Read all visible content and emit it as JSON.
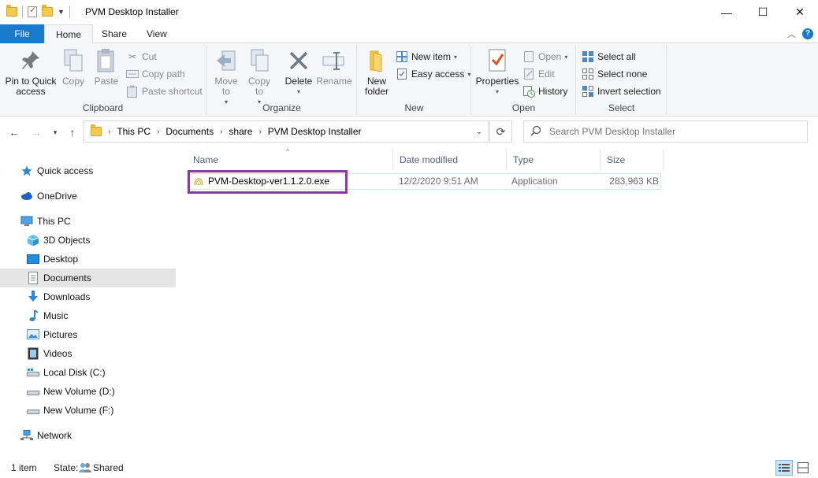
{
  "window": {
    "title": "PVM Desktop Installer",
    "minimize_glyph": "—",
    "maximize_glyph": "☐",
    "close_glyph": "✕"
  },
  "tabs": {
    "file": "File",
    "home": "Home",
    "share": "Share",
    "view": "View",
    "help_glyph": "?"
  },
  "ribbon": {
    "clipboard": {
      "label": "Clipboard",
      "pin": "Pin to Quick access",
      "copy": "Copy",
      "paste": "Paste",
      "cut": "Cut",
      "copy_path": "Copy path",
      "paste_shortcut": "Paste shortcut"
    },
    "organize": {
      "label": "Organize",
      "move_to": "Move to",
      "copy_to": "Copy to",
      "delete": "Delete",
      "rename": "Rename"
    },
    "new": {
      "label": "New",
      "new_folder": "New folder",
      "new_item": "New item",
      "easy_access": "Easy access"
    },
    "open": {
      "label": "Open",
      "properties": "Properties",
      "open": "Open",
      "edit": "Edit",
      "history": "History"
    },
    "select": {
      "label": "Select",
      "select_all": "Select all",
      "select_none": "Select none",
      "invert_selection": "Invert selection"
    }
  },
  "address": {
    "crumbs": [
      "This PC",
      "Documents",
      "share",
      "PVM Desktop Installer"
    ]
  },
  "search": {
    "placeholder": "Search PVM Desktop Installer"
  },
  "navpane": {
    "items": [
      {
        "label": "Quick access",
        "icon": "star-icon"
      },
      {
        "label": "OneDrive",
        "icon": "cloud-icon"
      },
      {
        "label": "This PC",
        "icon": "computer-icon"
      },
      {
        "label": "3D Objects",
        "icon": "cube-icon"
      },
      {
        "label": "Desktop",
        "icon": "desktop-icon"
      },
      {
        "label": "Documents",
        "icon": "document-icon"
      },
      {
        "label": "Downloads",
        "icon": "download-icon"
      },
      {
        "label": "Music",
        "icon": "music-icon"
      },
      {
        "label": "Pictures",
        "icon": "pictures-icon"
      },
      {
        "label": "Videos",
        "icon": "videos-icon"
      },
      {
        "label": "Local Disk (C:)",
        "icon": "drive-icon"
      },
      {
        "label": "New Volume (D:)",
        "icon": "drive-icon"
      },
      {
        "label": "New Volume (F:)",
        "icon": "drive-icon"
      },
      {
        "label": "Network",
        "icon": "network-icon"
      }
    ]
  },
  "columns": {
    "name": "Name",
    "date_modified": "Date modified",
    "type": "Type",
    "size": "Size"
  },
  "files": [
    {
      "name": "PVM-Desktop-ver1.1.2.0.exe",
      "date_modified": "12/2/2020 9:51 AM",
      "type": "Application",
      "size": "283,963 KB"
    }
  ],
  "status": {
    "count": "1 item",
    "state_label": "State:",
    "state_value": "Shared"
  },
  "colors": {
    "accent": "#1979ca",
    "highlight_border": "#8e3a9e",
    "selected_nav": "#e5e5e5"
  }
}
